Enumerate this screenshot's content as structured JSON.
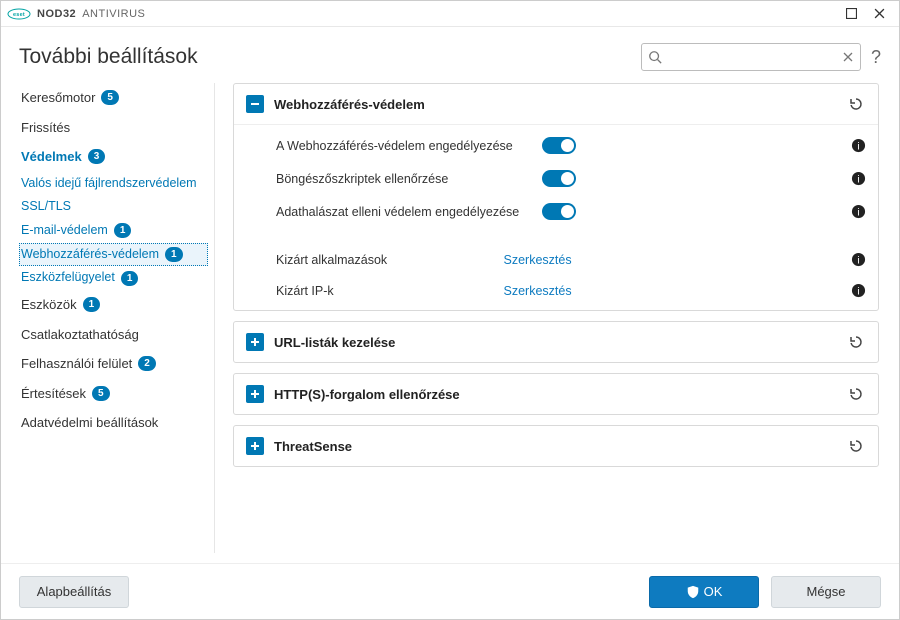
{
  "app": {
    "brand_bold": "NOD32",
    "brand_rest": "ANTIVIRUS"
  },
  "header": {
    "title": "További beállítások",
    "search_placeholder": ""
  },
  "sidebar": {
    "items": [
      {
        "label": "Keresőmotor",
        "badge": "5"
      },
      {
        "label": "Frissítés"
      },
      {
        "label": "Védelmek",
        "badge": "3",
        "accent": true
      },
      {
        "label": "Eszközök",
        "badge": "1"
      },
      {
        "label": "Csatlakoztathatóság"
      },
      {
        "label": "Felhasználói felület",
        "badge": "2"
      },
      {
        "label": "Értesítések",
        "badge": "5"
      },
      {
        "label": "Adatvédelmi beállítások"
      }
    ],
    "sub_items": [
      {
        "label": "Valós idejű fájlrendszervédelem"
      },
      {
        "label": "SSL/TLS"
      },
      {
        "label": "E-mail-védelem",
        "badge": "1"
      },
      {
        "label": "Webhozzáférés-védelem",
        "badge": "1",
        "selected": true
      },
      {
        "label": "Eszközfelügyelet",
        "badge": "1"
      }
    ]
  },
  "panels": {
    "web": {
      "title": "Webhozzáférés-védelem",
      "rows": [
        {
          "label": "A Webhozzáférés-védelem engedélyezése",
          "toggle": true
        },
        {
          "label": "Böngészőszkriptek ellenőrzése",
          "toggle": true
        },
        {
          "label": "Adathalászat elleni védelem engedélyezése",
          "toggle": true
        }
      ],
      "edit_rows": [
        {
          "label": "Kizárt alkalmazások",
          "action": "Szerkesztés"
        },
        {
          "label": "Kizárt IP-k",
          "action": "Szerkesztés"
        }
      ]
    },
    "url": {
      "title": "URL-listák kezelése"
    },
    "http": {
      "title": "HTTP(S)-forgalom ellenőrzése"
    },
    "ts": {
      "title": "ThreatSense"
    }
  },
  "footer": {
    "default": "Alapbeállítás",
    "ok": "OK",
    "cancel": "Mégse"
  }
}
